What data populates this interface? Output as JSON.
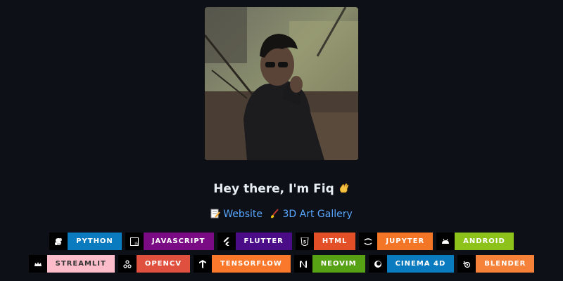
{
  "profile": {
    "greeting": "Hey there, I'm Fiq",
    "wave_emoji": "wave-hand-icon"
  },
  "links": [
    {
      "icon": "memo-icon",
      "label": "Website"
    },
    {
      "icon": "paintbrush-icon",
      "label": "3D Art Gallery"
    }
  ],
  "badges_row1": [
    {
      "icon": "python-icon",
      "label": "PYTHON",
      "color": "#0a7bbf",
      "text_color": "#ffffff"
    },
    {
      "icon": "js-icon",
      "label": "JAVASCRIPT",
      "color": "#7b0b84",
      "text_color": "#ffffff"
    },
    {
      "icon": "flutter-icon",
      "label": "FLUTTER",
      "color": "#4b0d87",
      "text_color": "#ffffff"
    },
    {
      "icon": "html5-icon",
      "label": "HTML",
      "color": "#e34f26",
      "text_color": "#ffffff"
    },
    {
      "icon": "jupyter-icon",
      "label": "JUPYTER",
      "color": "#f37626",
      "text_color": "#ffffff"
    },
    {
      "icon": "android-icon",
      "label": "ANDROID",
      "color": "#8dc21b",
      "text_color": "#ffffff"
    }
  ],
  "badges_row2": [
    {
      "icon": "streamlit-icon",
      "label": "STREAMLIT",
      "color": "#fdbcc9",
      "text_color": "#333333"
    },
    {
      "icon": "opencv-icon",
      "label": "OPENCV",
      "color": "#e0503f",
      "text_color": "#ffffff"
    },
    {
      "icon": "tensorflow-icon",
      "label": "TENSORFLOW",
      "color": "#f9782b",
      "text_color": "#ffffff"
    },
    {
      "icon": "neovim-icon",
      "label": "NEOVIM",
      "color": "#57a115",
      "text_color": "#ffffff"
    },
    {
      "icon": "cinema4d-icon",
      "label": "CINEMA 4D",
      "color": "#0a7bbf",
      "text_color": "#ffffff"
    },
    {
      "icon": "blender-icon",
      "label": "BLENDER",
      "color": "#f6823a",
      "text_color": "#ffffff"
    }
  ]
}
